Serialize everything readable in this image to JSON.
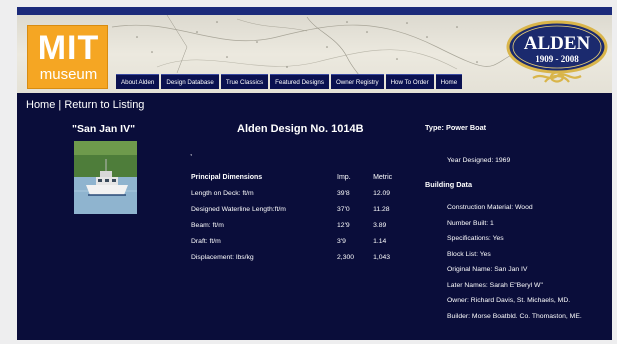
{
  "header": {
    "mit_logo": {
      "line1": "MIT",
      "line2": "museum"
    },
    "alden_logo": {
      "name": "ALDEN",
      "years": "1909 - 2008"
    },
    "nav": [
      "About Alden",
      "Design Database",
      "True Classics",
      "Featured Designs",
      "Owner Registry",
      "How To Order",
      "Home"
    ]
  },
  "breadcrumb": {
    "home": "Home",
    "separator": " | ",
    "return": "Return to Listing"
  },
  "boat": {
    "name": "\"San Jan IV\"",
    "design_title": "Alden Design No. 1014B",
    "tick": ","
  },
  "dimensions": {
    "header": {
      "label": "Principal Dimensions",
      "imp": "Imp.",
      "metric": "Metric"
    },
    "rows": [
      {
        "label": "Length on Deck: ft/m",
        "imp": "39'8",
        "metric": "12.09"
      },
      {
        "label": "Designed Waterline Length:ft/m",
        "imp": "37'0",
        "metric": "11.28"
      },
      {
        "label": "Beam: ft/m",
        "imp": "12'9",
        "metric": "3.89"
      },
      {
        "label": "Draft: ft/m",
        "imp": "3'9",
        "metric": "1.14"
      },
      {
        "label": "Displacement: lbs/kg",
        "imp": "2,300",
        "metric": "1,043"
      }
    ]
  },
  "info": {
    "type": "Type: Power Boat",
    "year": "Year Designed: 1969",
    "building_title": "Building Data",
    "building": [
      "Construction Material: Wood",
      "Number Built: 1",
      "Specifications: Yes",
      "Block List: Yes",
      "Original Name: San Jan IV",
      "Later Names: Sarah E\"Beryl W\"",
      "Owner: Richard Davis, St. Michaels, MD.",
      "Builder: Morse Boatbld. Co. Thomaston, ME."
    ]
  },
  "colors": {
    "background": "#0a0d3a",
    "nav_bg": "#0a1150",
    "mit_orange": "#f5a623",
    "alden_navy": "#1b2a6e",
    "alden_gold": "#d9b54a"
  },
  "icons": {
    "boat_photo": "boat-photo",
    "rope_knot": "rope-knot-icon"
  }
}
